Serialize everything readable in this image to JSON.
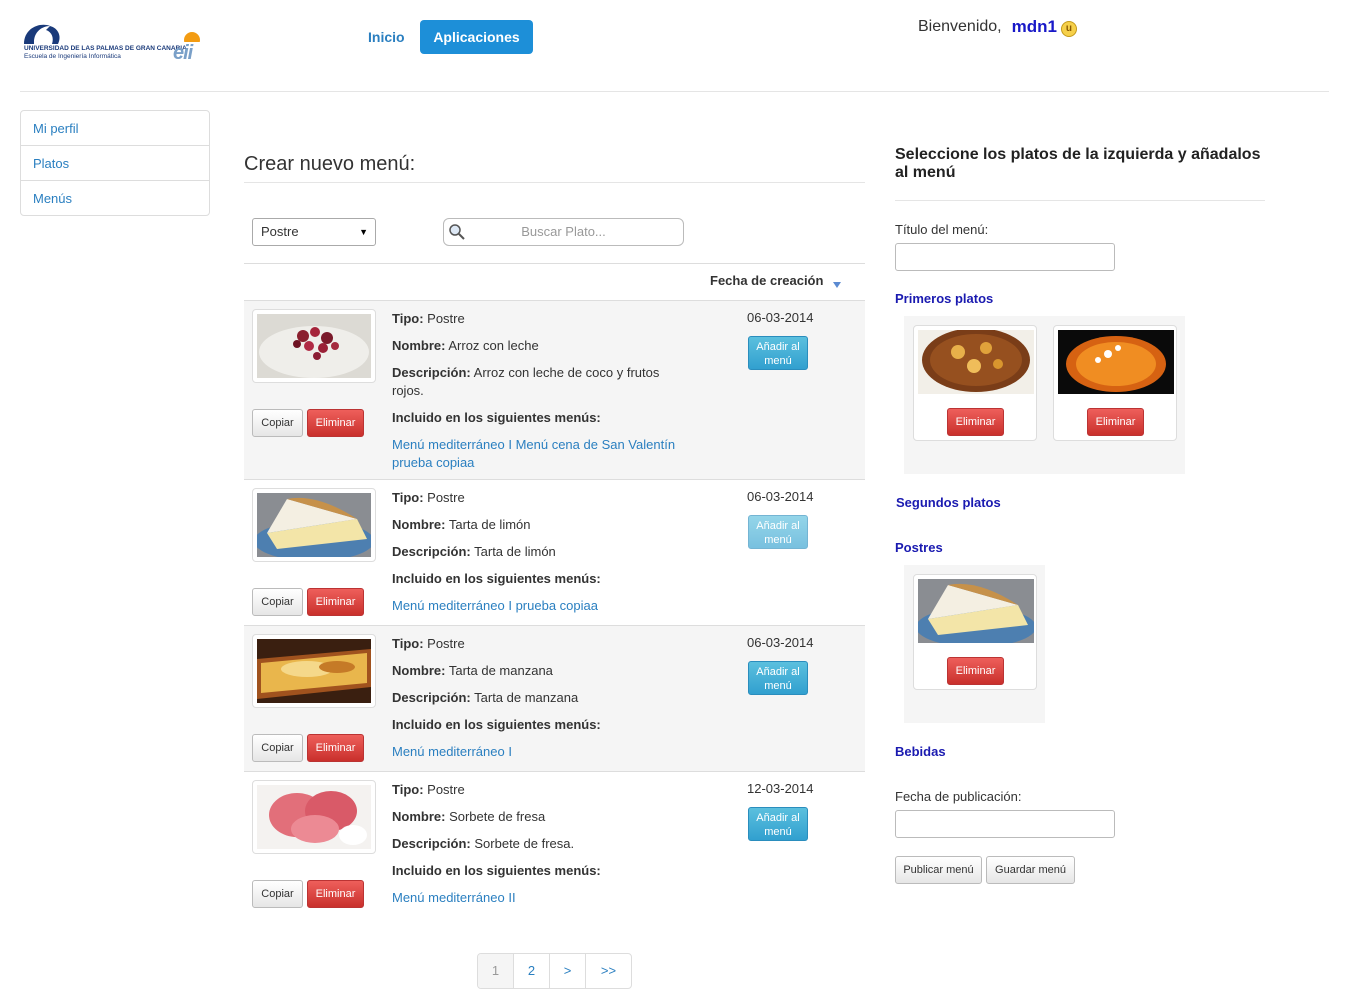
{
  "header": {
    "logo_line1": "UNIVERSIDAD DE LAS PALMAS DE GRAN CANARIA",
    "logo_line2": "Escuela de Ingeniería Informática",
    "logo_mark": "eii",
    "nav": [
      {
        "label": "Inicio",
        "active": false
      },
      {
        "label": "Aplicaciones",
        "active": true
      }
    ],
    "welcome_text": "Bienvenido,",
    "username": "mdn1",
    "user_icon": "user-badge-icon"
  },
  "sidebar": {
    "items": [
      {
        "label": "Mi perfil"
      },
      {
        "label": "Platos"
      },
      {
        "label": "Menús"
      }
    ]
  },
  "main": {
    "title": "Crear nuevo menú:",
    "filter_select": {
      "selected": "Postre"
    },
    "search": {
      "placeholder": "Buscar Plato..."
    },
    "column_header": "Fecha de creación",
    "labels": {
      "tipo": "Tipo:",
      "nombre": "Nombre:",
      "descripcion": "Descripción:",
      "incluido": "Incluido en los siguientes menús:",
      "copiar": "Copiar",
      "eliminar": "Eliminar",
      "add_line1": "Añadir al",
      "add_line2": "menú"
    },
    "rows": [
      {
        "tipo": "Postre",
        "nombre": "Arroz con leche",
        "descripcion": "Arroz con leche de coco y frutos rojos.",
        "menus": "Menú mediterráneo I Menú cena de San Valentín prueba copiaa",
        "fecha": "06-03-2014",
        "add_enabled": true
      },
      {
        "tipo": "Postre",
        "nombre": "Tarta de limón",
        "descripcion": "Tarta de limón",
        "menus": "Menú mediterráneo I prueba copiaa",
        "fecha": "06-03-2014",
        "add_enabled": false
      },
      {
        "tipo": "Postre",
        "nombre": "Tarta de manzana",
        "descripcion": "Tarta de manzana",
        "menus": "Menú mediterráneo I",
        "fecha": "06-03-2014",
        "add_enabled": true
      },
      {
        "tipo": "Postre",
        "nombre": "Sorbete de fresa",
        "descripcion": "Sorbete de fresa.",
        "menus": "Menú mediterráneo II",
        "fecha": "12-03-2014",
        "add_enabled": true
      }
    ],
    "pagination": [
      "1",
      "2",
      ">",
      ">>"
    ],
    "current_page": "1"
  },
  "right_panel": {
    "title": "Seleccione los platos de la izquierda y añadalos al menú",
    "menu_title_label": "Título del menú:",
    "menu_title_value": "",
    "sections": {
      "primeros": "Primeros platos",
      "segundos": "Segundos platos",
      "postres": "Postres",
      "bebidas": "Bebidas"
    },
    "eliminar_label": "Eliminar",
    "publication_date_label": "Fecha de publicación:",
    "publication_date_value": "",
    "publish_button": "Publicar menú",
    "save_button": "Guardar menú"
  },
  "colors": {
    "primary": "#1d8fd8",
    "link": "#2a7fc0",
    "danger": "#d9534f",
    "info": "#5bc0de",
    "section_title": "#1a1ab0",
    "username": "#1818c8"
  }
}
